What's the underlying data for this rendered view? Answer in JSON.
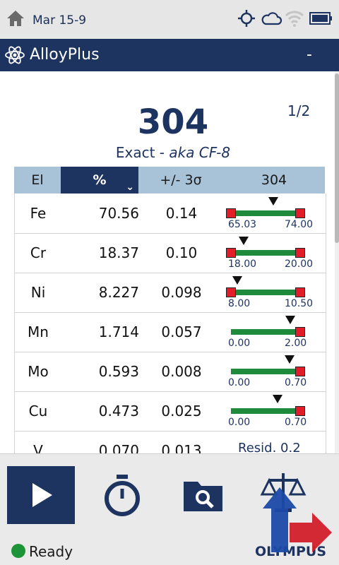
{
  "status_bar": {
    "date": "Mar 15-9",
    "icons": [
      "home-icon",
      "crosshair-icon",
      "cloud-icon",
      "wifi-icon",
      "battery-icon"
    ]
  },
  "app": {
    "title": "AlloyPlus",
    "minimize": "-",
    "icon": "atom-icon"
  },
  "result": {
    "grade": "304",
    "page": "1/2",
    "match_type": "Exact - ",
    "aka": "aka CF-8"
  },
  "table": {
    "headers": [
      "El",
      "%",
      "+/- 3σ",
      "304"
    ],
    "rows": [
      {
        "el": "Fe",
        "pct": "70.56",
        "sigma": "0.14",
        "min": "65.03",
        "max": "74.00",
        "value": 70.56,
        "lo": 65.03,
        "hi": 74.0,
        "min_marker": true,
        "max_marker": true
      },
      {
        "el": "Cr",
        "pct": "18.37",
        "sigma": "0.10",
        "min": "18.00",
        "max": "20.00",
        "value": 18.37,
        "lo": 18.0,
        "hi": 20.0,
        "min_marker": true,
        "max_marker": true
      },
      {
        "el": "Ni",
        "pct": "8.227",
        "sigma": "0.098",
        "min": "8.00",
        "max": "10.50",
        "value": 8.227,
        "lo": 8.0,
        "hi": 10.5,
        "min_marker": true,
        "max_marker": true
      },
      {
        "el": "Mn",
        "pct": "1.714",
        "sigma": "0.057",
        "min": "0.00",
        "max": "2.00",
        "value": 1.714,
        "lo": 0.0,
        "hi": 2.0,
        "min_marker": false,
        "max_marker": true
      },
      {
        "el": "Mo",
        "pct": "0.593",
        "sigma": "0.008",
        "min": "0.00",
        "max": "0.70",
        "value": 0.593,
        "lo": 0.0,
        "hi": 0.7,
        "min_marker": false,
        "max_marker": true
      },
      {
        "el": "Cu",
        "pct": "0.473",
        "sigma": "0.025",
        "min": "0.00",
        "max": "0.70",
        "value": 0.473,
        "lo": 0.0,
        "hi": 0.7,
        "min_marker": false,
        "max_marker": true
      },
      {
        "el": "V",
        "pct": "0.070",
        "sigma": "0.013",
        "resid": "Resid. 0.2"
      }
    ]
  },
  "nav": {
    "buttons": [
      "play-icon",
      "stopwatch-icon",
      "folder-search-icon",
      "scale-icon"
    ]
  },
  "footer": {
    "status": "Ready",
    "brand": "OLYMPUS"
  },
  "colors": {
    "navy": "#1d3461",
    "header_blue": "#a8c3d8",
    "in_range": "#1f8a3c",
    "limit": "#e11d2a",
    "ready": "#1e9438"
  }
}
